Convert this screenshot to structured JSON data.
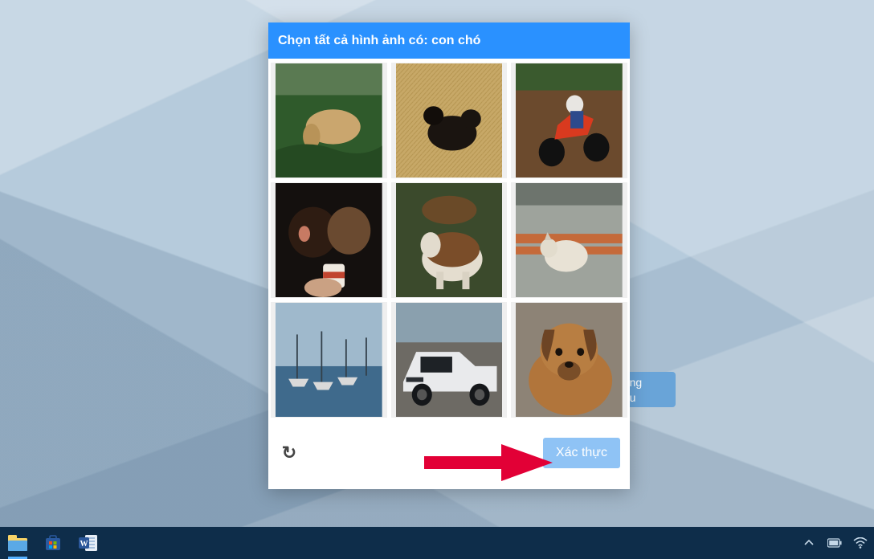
{
  "captcha": {
    "instruction_prefix": "Chọn tất cả hình ảnh có: ",
    "instruction_target": "con chó",
    "verify_label": "Xác thực",
    "refresh_icon": "refresh-cw-icon",
    "tiles": [
      {
        "id": 0,
        "content": "dog-on-grass",
        "is_target": true
      },
      {
        "id": 1,
        "content": "dogs-on-hay",
        "is_target": true
      },
      {
        "id": 2,
        "content": "motocross-rider",
        "is_target": false
      },
      {
        "id": 3,
        "content": "two-dogs-yogurt",
        "is_target": true
      },
      {
        "id": 4,
        "content": "dog-painting",
        "is_target": true
      },
      {
        "id": 5,
        "content": "cat-on-concrete",
        "is_target": false
      },
      {
        "id": 6,
        "content": "boats-in-harbor",
        "is_target": false
      },
      {
        "id": 7,
        "content": "white-pickup-truck",
        "is_target": false
      },
      {
        "id": 8,
        "content": "brown-puppy",
        "is_target": true
      }
    ]
  },
  "behind_button": {
    "line1": "không",
    "line2": "khẩu"
  },
  "annotation": {
    "arrow": "red-arrow-pointing-right"
  },
  "taskbar": {
    "apps": [
      {
        "name": "file-explorer",
        "active": true
      },
      {
        "name": "microsoft-store",
        "active": false
      },
      {
        "name": "microsoft-word",
        "active": false
      }
    ],
    "tray": [
      "chevron-up-icon",
      "battery-icon",
      "wifi-icon"
    ]
  },
  "colors": {
    "header_bg": "#2a91ff",
    "verify_bg": "#8fc3f5",
    "arrow": "#e20036",
    "taskbar": "#0e2d4a"
  }
}
